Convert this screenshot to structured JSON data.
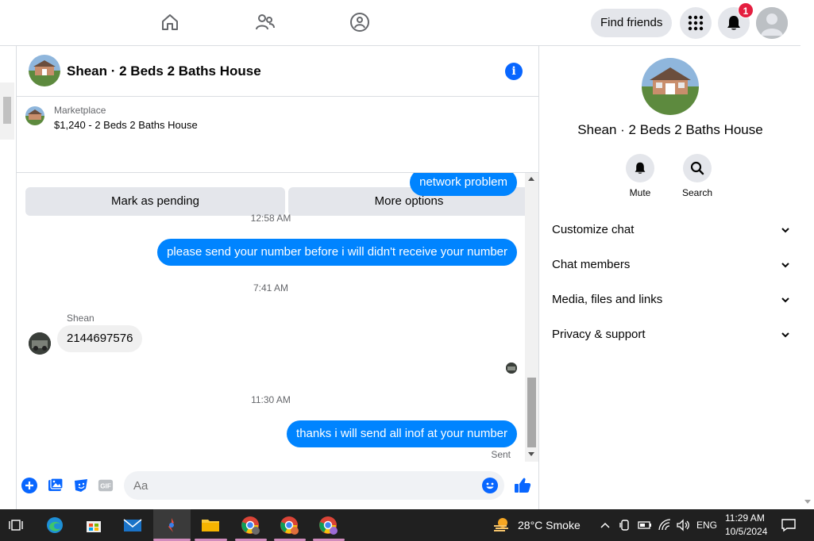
{
  "topnav": {
    "find_friends": "Find friends",
    "notif_count": "1"
  },
  "chat": {
    "title": "Shean · 2 Beds 2 Baths House",
    "marketplace_label": "Marketplace",
    "listing": "$1,240 - 2 Beds 2 Baths House",
    "mark_pending": "Mark as pending",
    "more_options": "More options",
    "messages": [
      {
        "type": "out",
        "text": "network problem"
      },
      {
        "type": "time",
        "text": "12:58 AM"
      },
      {
        "type": "out",
        "text": "please send your number before i will didn't receive your number"
      },
      {
        "type": "time",
        "text": "7:41 AM"
      },
      {
        "type": "sender",
        "text": "Shean"
      },
      {
        "type": "in",
        "text": "2144697576"
      },
      {
        "type": "time",
        "text": "11:30 AM"
      },
      {
        "type": "out",
        "text": "thanks i will send all inof at your number"
      },
      {
        "type": "status",
        "text": "Sent"
      }
    ],
    "composer_placeholder": "Aa"
  },
  "sidebar": {
    "title": "Shean · 2 Beds 2 Baths House",
    "mute": "Mute",
    "search": "Search",
    "rows": [
      "Customize chat",
      "Chat members",
      "Media, files and links",
      "Privacy & support"
    ]
  },
  "taskbar": {
    "weather": "28°C  Smoke",
    "lang": "ENG",
    "time": "11:29 AM",
    "date": "10/5/2024"
  },
  "colors": {
    "accent": "#0866ff",
    "bubble": "#0084ff",
    "badge": "#e41e3f"
  }
}
